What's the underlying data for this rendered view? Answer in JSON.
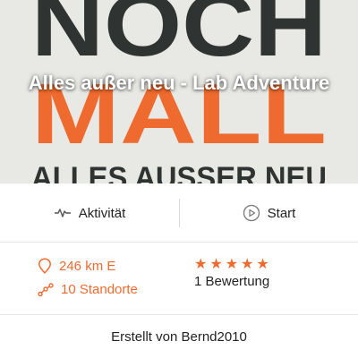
{
  "hero": {
    "title": "Alles außer neu - Lab Adventure",
    "image_text": {
      "line1": "NOCH",
      "line2": "MALL",
      "line3": "ALLES AUSSER NEU"
    }
  },
  "actions": {
    "activity_label": "Aktivität",
    "start_label": "Start"
  },
  "stats": {
    "distance": "246 km E",
    "locations": "10 Standorte",
    "rating_stars": 5,
    "rating_label": "1 Bewertung"
  },
  "footer": {
    "created_by": "Erstellt von Bernd2010"
  },
  "colors": {
    "accent": "#ef6a2e",
    "poster_dark": "#2f3433",
    "poster_orange": "#ef6a2e"
  }
}
